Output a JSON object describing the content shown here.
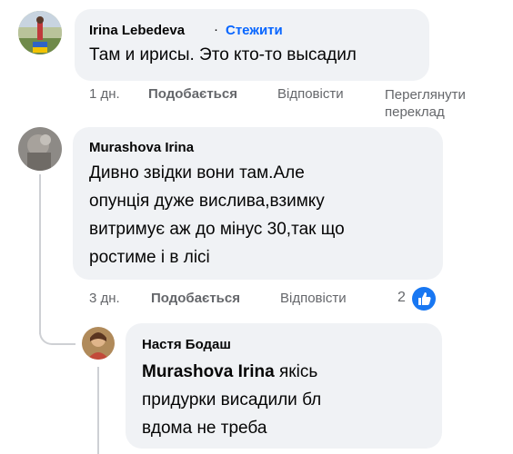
{
  "comments": [
    {
      "author": "Irina Lebedeva",
      "separator": "·",
      "follow_label": "Стежити",
      "text": "Там и ирисы. Это кто-то высадил",
      "time": "1 дн.",
      "like_label": "Подобається",
      "reply_label": "Відповісти",
      "translate_label_line1": "Переглянути",
      "translate_label_line2": "переклад"
    },
    {
      "author": "Murashova Irina",
      "text_lines": [
        "Дивно звідки вони там.Але",
        "опунція дуже вислива,взимку",
        "витримує аж до мінус 30,так що",
        "ростиме і в лісі"
      ],
      "time": "3 дн.",
      "like_label": "Подобається",
      "reply_label": "Відповісти",
      "reaction_count": "2",
      "reaction_icon": "like-icon"
    },
    {
      "author": "Настя Бодаш",
      "mention": "Murashova Irina",
      "text_line1_rest": " якісь",
      "text_lines_more": [
        "придурки висадили бл",
        "вдома не треба"
      ]
    }
  ],
  "colors": {
    "bubble": "#f0f2f5",
    "link": "#0866ff",
    "secondary": "#65676b",
    "like": "#1877f2"
  }
}
